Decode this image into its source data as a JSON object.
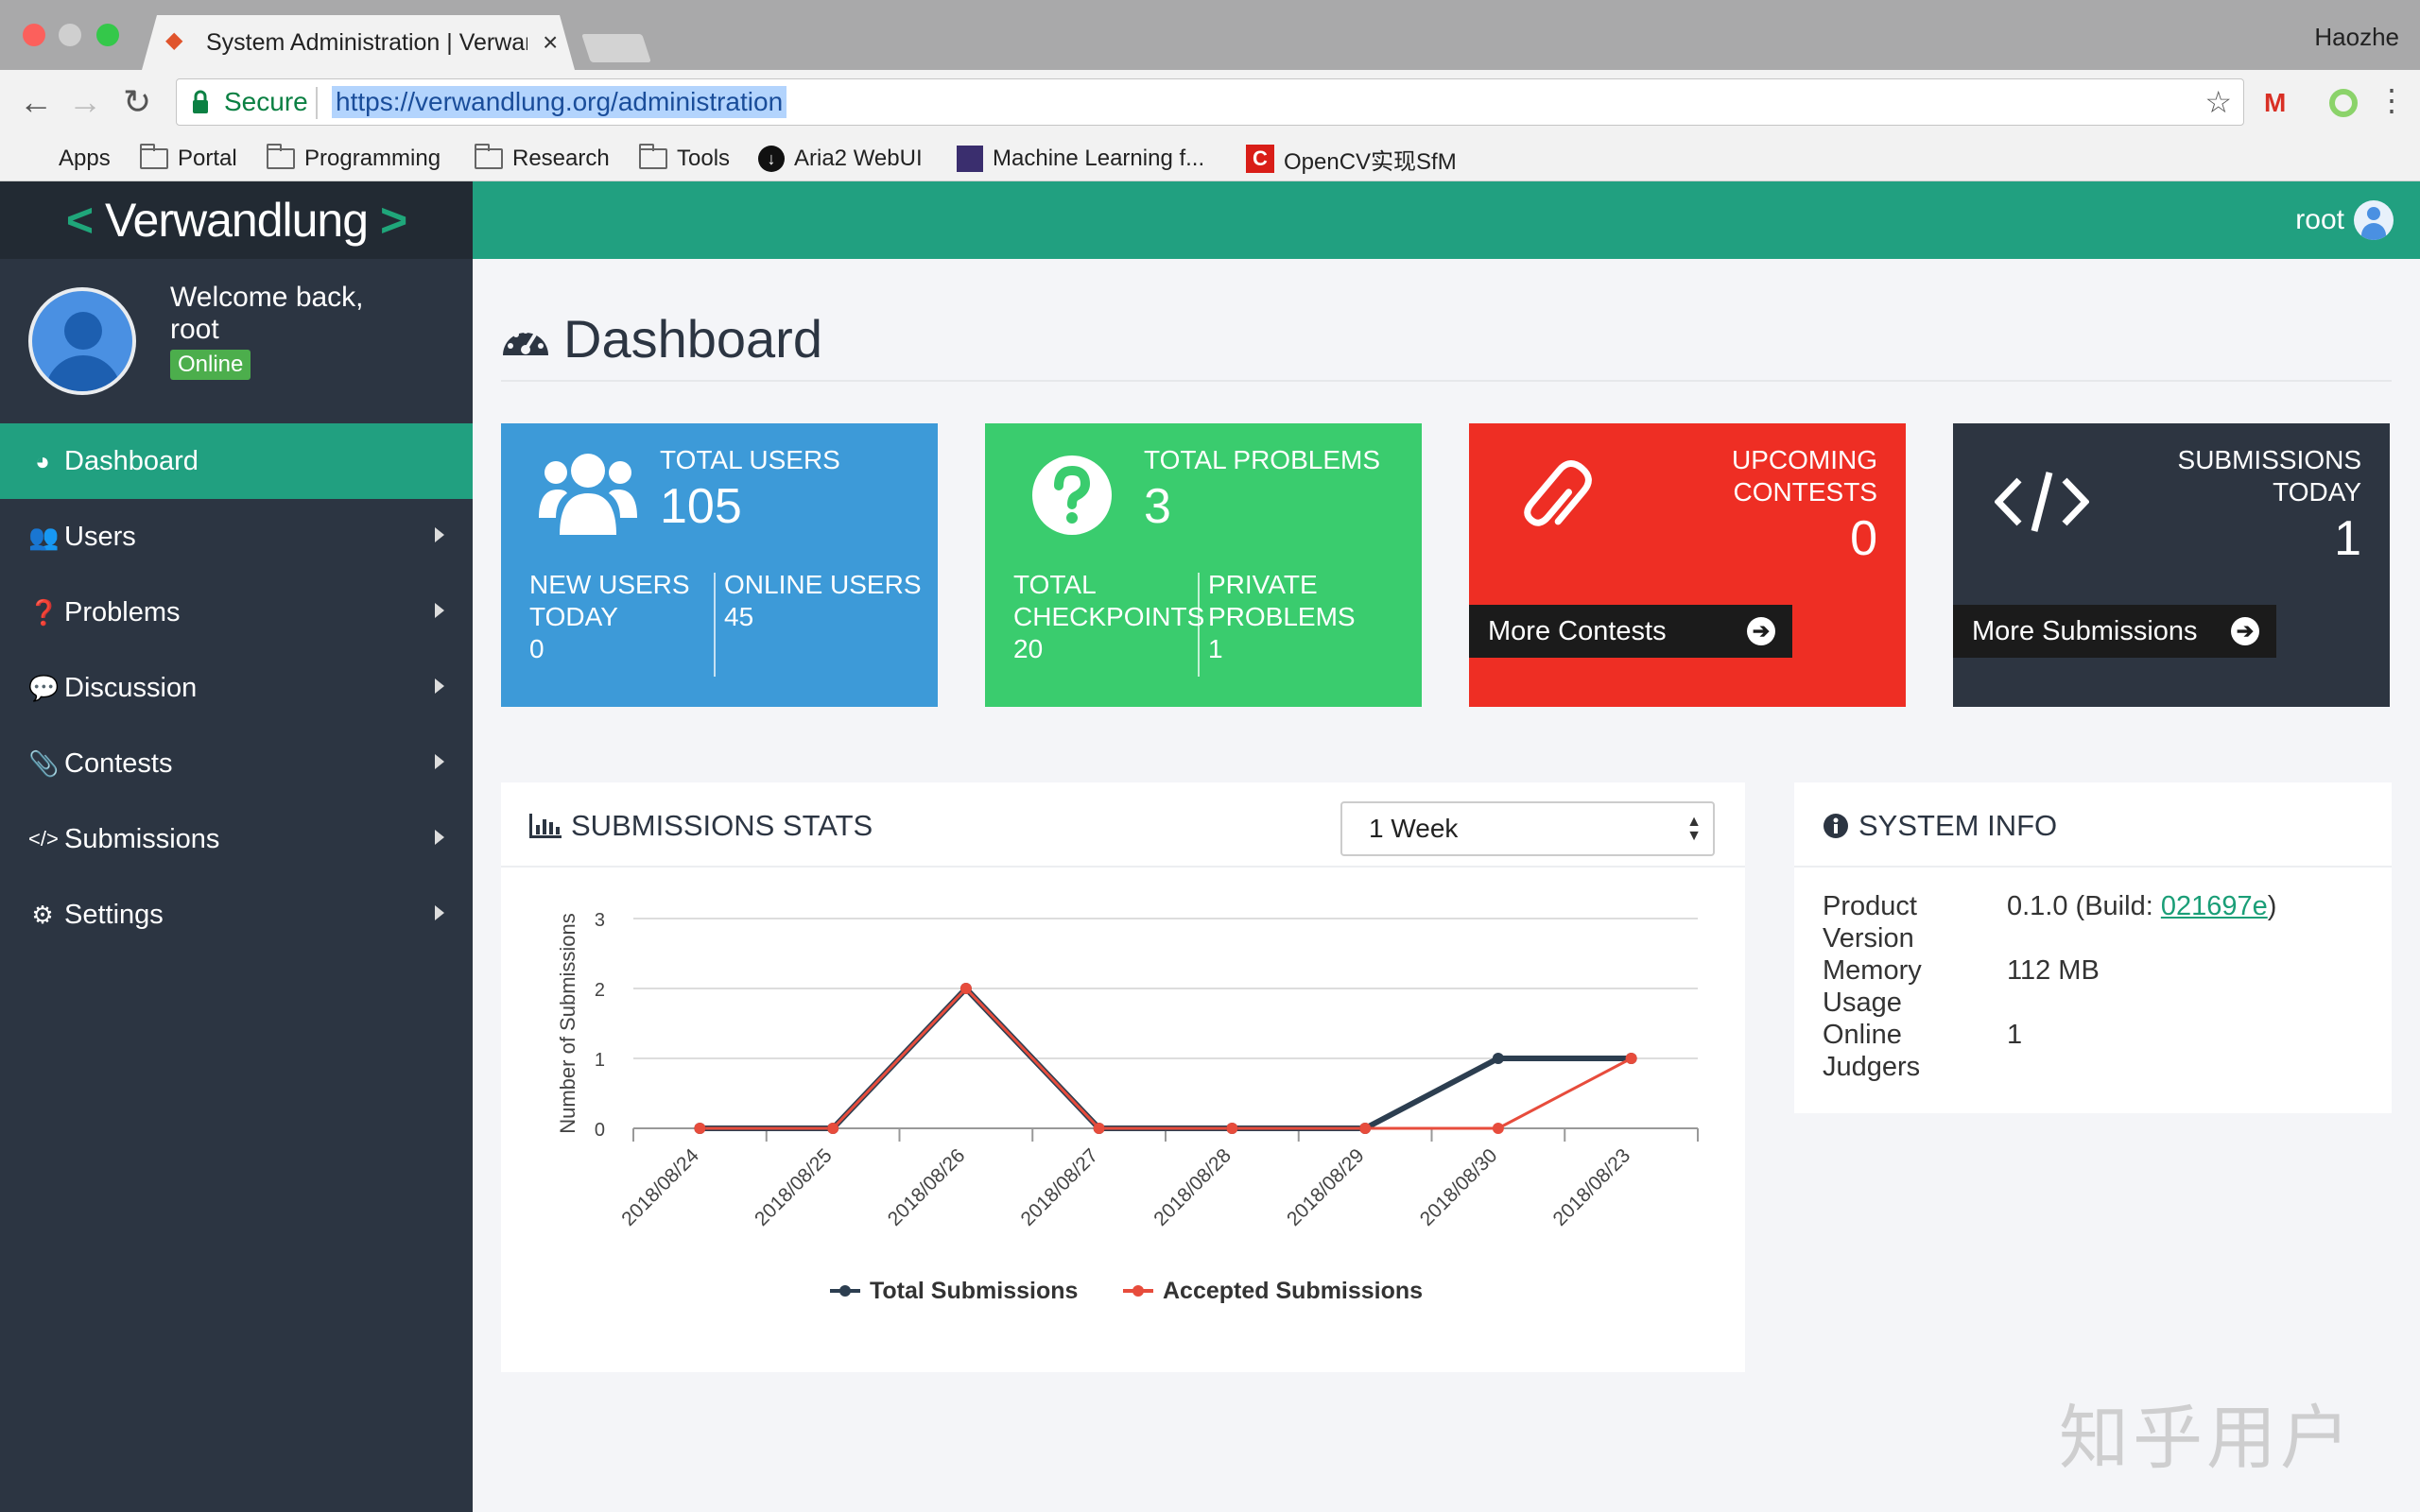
{
  "browser": {
    "tab_title": "System Administration | Verwandlung",
    "tab_close": "×",
    "profile_name": "Haozhe",
    "secure_label": "Secure",
    "url": "https://verwandlung.org/administration",
    "bookmarks": {
      "apps": "Apps",
      "portal": "Portal",
      "programming": "Programming",
      "research": "Research",
      "tools": "Tools",
      "aria2": "Aria2 WebUI",
      "ml": "Machine Learning f...",
      "opencv": "OpenCV实现SfM"
    }
  },
  "brand": {
    "left": "<",
    "name": "Verwandlung",
    "right": ">"
  },
  "user": {
    "welcome": "Welcome back,",
    "name": "root",
    "status": "Online"
  },
  "nav": {
    "dashboard": "Dashboard",
    "users": "Users",
    "problems": "Problems",
    "discussion": "Discussion",
    "contests": "Contests",
    "submissions": "Submissions",
    "settings": "Settings"
  },
  "page": {
    "title": "Dashboard"
  },
  "cards": {
    "users": {
      "label": "TOTAL USERS",
      "value": "105",
      "new_label_1": "NEW USERS",
      "new_label_2": "TODAY",
      "new_value": "0",
      "online_label": "ONLINE USERS",
      "online_value": "45",
      "color": "#3d9ad8"
    },
    "problems": {
      "label": "TOTAL PROBLEMS",
      "value": "3",
      "cp_label_1": "TOTAL",
      "cp_label_2": "CHECKPOINTS",
      "cp_value": "20",
      "priv_label_1": "PRIVATE",
      "priv_label_2": "PROBLEMS",
      "priv_value": "1",
      "color": "#3acc6e"
    },
    "contests": {
      "label_1": "UPCOMING",
      "label_2": "CONTESTS",
      "value": "0",
      "button": "More Contests",
      "color": "#ee2e24"
    },
    "submissions": {
      "label_1": "SUBMISSIONS",
      "label_2": "TODAY",
      "value": "1",
      "button": "More Submissions",
      "color": "#2d3541"
    }
  },
  "stats_panel": {
    "title": "SUBMISSIONS STATS",
    "range": "1 Week"
  },
  "chart_data": {
    "type": "line",
    "categories": [
      "2018/08/24",
      "2018/08/25",
      "2018/08/26",
      "2018/08/27",
      "2018/08/28",
      "2018/08/29",
      "2018/08/30",
      "2018/08/23"
    ],
    "series": [
      {
        "name": "Total Submissions",
        "values": [
          0,
          0,
          2,
          0,
          0,
          0,
          1,
          1
        ],
        "color": "#2c3e50"
      },
      {
        "name": "Accepted Submissions",
        "values": [
          0,
          0,
          2,
          0,
          0,
          0,
          0,
          1
        ],
        "color": "#e74c3c"
      }
    ],
    "ylabel": "Number of Submissions",
    "yticks": [
      0,
      1,
      2,
      3
    ],
    "ylim": [
      0,
      3
    ],
    "grid": true,
    "legend": "bottom"
  },
  "system_info": {
    "title": "SYSTEM INFO",
    "product_label_1": "Product",
    "product_label_2": "Version",
    "product_value": "0.1.0 (Build: ",
    "build_link": "021697e",
    "product_tail": ")",
    "memory_label_1": "Memory",
    "memory_label_2": "Usage",
    "memory_value": "112 MB",
    "judgers_label_1": "Online",
    "judgers_label_2": "Judgers",
    "judgers_value": "1"
  },
  "watermark": "知乎用户"
}
